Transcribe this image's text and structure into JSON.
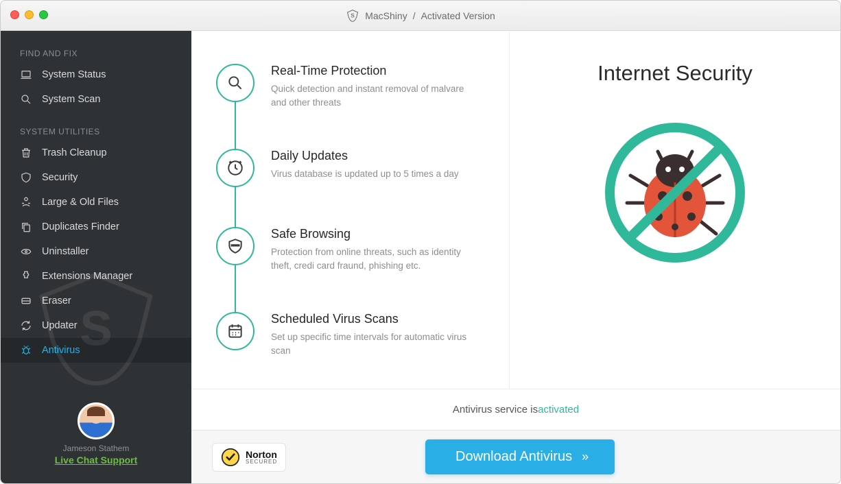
{
  "titlebar": {
    "app_name": "MacShiny",
    "separator": "/",
    "status": "Activated Version"
  },
  "sidebar": {
    "sections": [
      {
        "label": "FIND AND FIX",
        "items": [
          {
            "icon": "laptop-icon",
            "label": "System Status"
          },
          {
            "icon": "search-icon",
            "label": "System Scan"
          }
        ]
      },
      {
        "label": "SYSTEM UTILITIES",
        "items": [
          {
            "icon": "trash-icon",
            "label": "Trash Cleanup"
          },
          {
            "icon": "shield-icon",
            "label": "Security"
          },
          {
            "icon": "files-icon",
            "label": "Large & Old Files"
          },
          {
            "icon": "copy-icon",
            "label": "Duplicates Finder"
          },
          {
            "icon": "uninstall-icon",
            "label": "Uninstaller"
          },
          {
            "icon": "puzzle-icon",
            "label": "Extensions Manager"
          },
          {
            "icon": "eraser-icon",
            "label": "Eraser"
          },
          {
            "icon": "refresh-icon",
            "label": "Updater"
          },
          {
            "icon": "bug-icon",
            "label": "Antivirus",
            "active": true
          }
        ]
      }
    ],
    "support": {
      "name": "Jameson Stathem",
      "link_label": "Live Chat Support"
    }
  },
  "features": [
    {
      "icon": "magnifier-icon",
      "title": "Real-Time Protection",
      "desc": "Quick detection and instant removal of malvare and other threats"
    },
    {
      "icon": "clock-icon",
      "title": "Daily Updates",
      "desc": "Virus database is updated up to 5 times a day"
    },
    {
      "icon": "shield-badge-icon",
      "title": "Safe Browsing",
      "desc": "Protection from online threats, such as identity theft, credi card fraund, phishing etc."
    },
    {
      "icon": "calendar-icon",
      "title": "Scheduled Virus Scans",
      "desc": "Set up specific time intervals for automatic virus scan"
    }
  ],
  "rightpane": {
    "heading": "Internet Security"
  },
  "status": {
    "prefix": "Antivirus service is ",
    "state": "activated"
  },
  "bottombar": {
    "norton_brand": "Norton",
    "norton_tag": "SECURED",
    "download_label": "Download Antivirus"
  },
  "colors": {
    "accent": "#2fb89a",
    "link_blue": "#1fb3ee",
    "button_blue": "#2aaee6",
    "support_green": "#6bbf3f"
  }
}
